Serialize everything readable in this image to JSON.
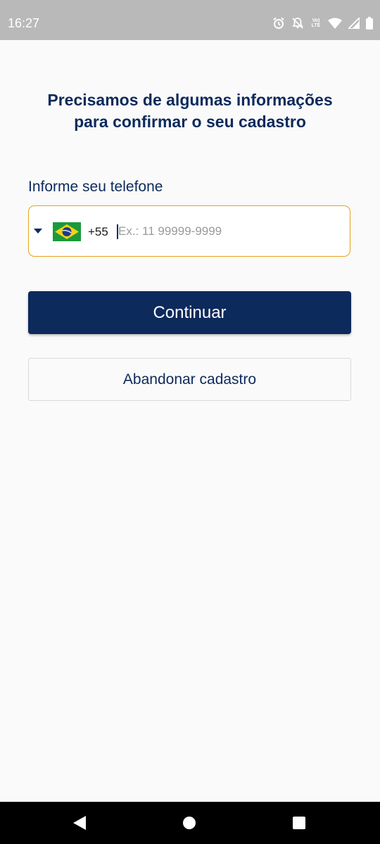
{
  "status_bar": {
    "time": "16:27",
    "volte_line1": "Vo)",
    "volte_line2": "LTE",
    "icons": [
      "alarm-icon",
      "notifications-off-icon",
      "volte-icon",
      "wifi-icon",
      "cell-signal-icon",
      "battery-icon"
    ]
  },
  "page": {
    "title": "Precisamos de algumas informações\npara confirmar o seu cadastro"
  },
  "phone": {
    "label": "Informe seu telefone",
    "country_flag": "brazil-flag-icon",
    "country_code": "+55",
    "value": "",
    "placeholder": "Ex.: 11 99999-9999"
  },
  "buttons": {
    "continue_label": "Continuar",
    "abandon_label": "Abandonar cadastro"
  },
  "colors": {
    "primary": "#0d2a5c",
    "focus_border": "#e6a21a",
    "background": "#fafafa",
    "status_bar": "#b9b9b9"
  },
  "nav_bar": {
    "icons": [
      "back-icon",
      "home-icon",
      "recents-icon"
    ]
  }
}
